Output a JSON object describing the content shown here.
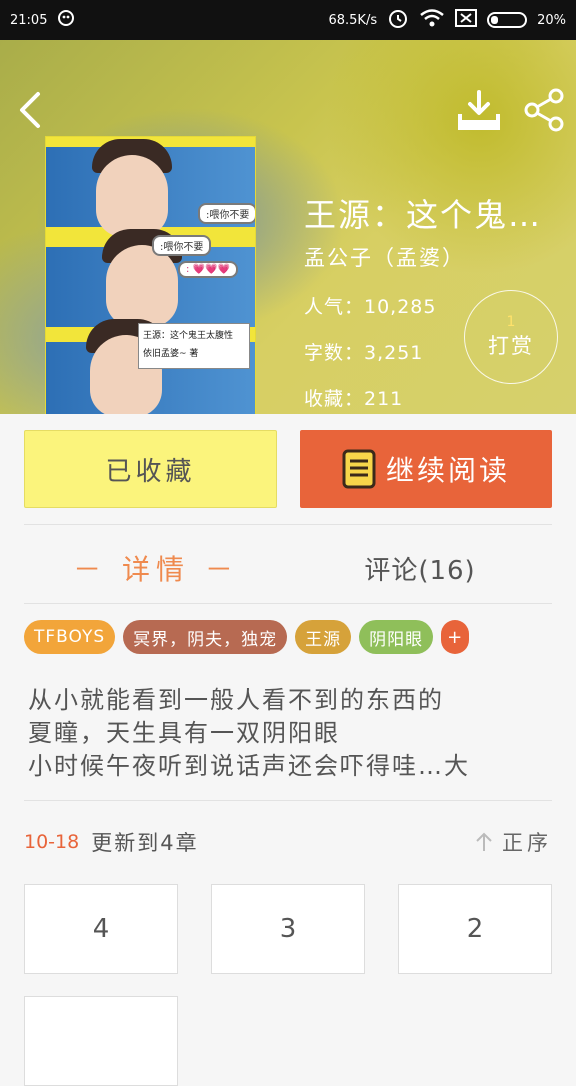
{
  "status_bar": {
    "time": "21:05",
    "net_speed": "68.5K/s",
    "battery": "20%"
  },
  "book": {
    "title": "王源：这个鬼…",
    "author": "孟公子（孟婆）",
    "popularity": "人气：10,285",
    "word_count": "字数：3,251",
    "favorites": "收藏：211"
  },
  "cover": {
    "bubble_1": ":喂你不要",
    "bubble_2": ":喂你不要",
    "bubble_3": ": 💗💗💗",
    "title_line": "王源：这个鬼王太腹性",
    "author_line": "依旧孟婆~   著"
  },
  "tip": {
    "count": "1",
    "label": "打赏"
  },
  "actions": {
    "collected": "已收藏",
    "continue_reading": "继续阅读"
  },
  "tabs": {
    "detail": "－ 详情 －",
    "comments": "评论(16)"
  },
  "tags": [
    {
      "label": "TFBOYS",
      "color": "#f2a53a"
    },
    {
      "label": "冥界，阴夫，独宠",
      "color": "#b76a52"
    },
    {
      "label": "王源",
      "color": "#d6a23a"
    },
    {
      "label": "阴阳眼",
      "color": "#8fbf5a"
    },
    {
      "label": "+",
      "color": "#e8643a"
    }
  ],
  "intro": [
    "从小就能看到一般人看不到的东西的",
    "夏瞳，天生具有一双阴阳眼",
    "小时候午夜听到说话声还会吓得哇…大"
  ],
  "update": {
    "date": "10-18",
    "text": "更新到4章",
    "sort": "正序"
  },
  "chapters": [
    "4",
    "3",
    "2",
    ""
  ]
}
